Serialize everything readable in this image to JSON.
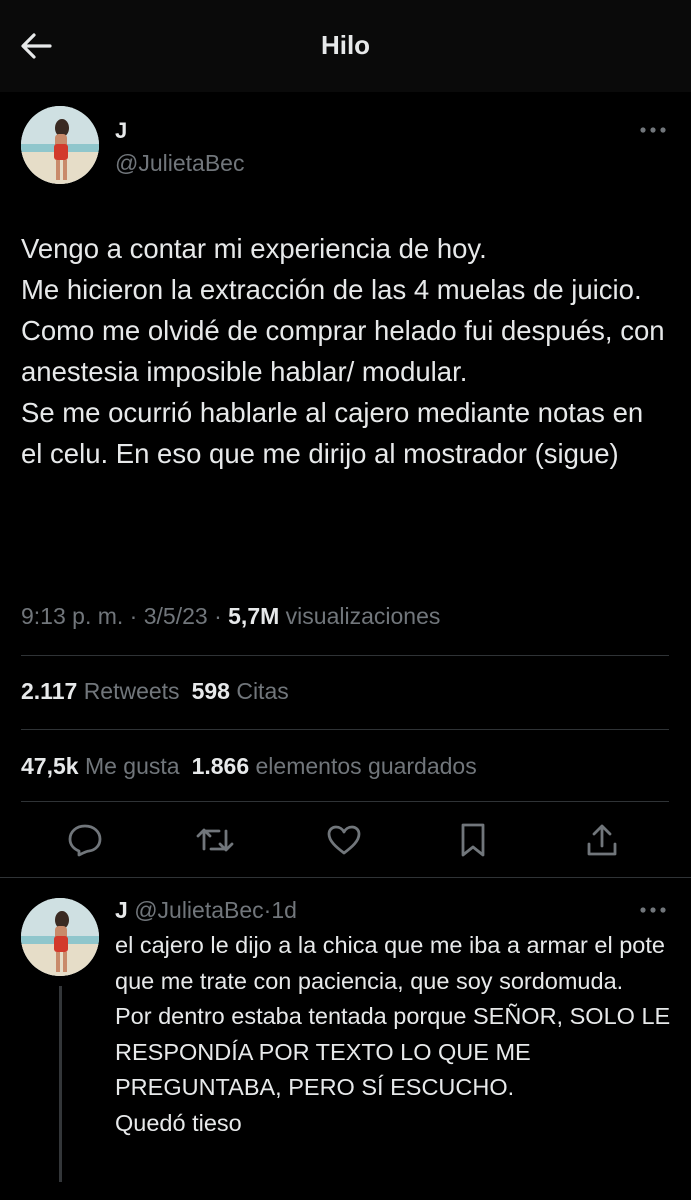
{
  "header": {
    "title": "Hilo"
  },
  "tweet": {
    "author_name": "J",
    "author_handle": "@JulietaBec",
    "text": "Vengo a contar mi experiencia de hoy.\nMe hicieron la extracción de las 4 muelas de juicio. Como me olvidé de comprar helado fui después, con anestesia imposible hablar/ modular.\nSe me ocurrió hablarle al cajero mediante notas en el celu. En eso que me dirijo al mostrador (sigue)",
    "time": "9:13 p. m.",
    "sep1": " · ",
    "date": "3/5/23",
    "sep2": " · ",
    "views_count": "5,7M",
    "views_label": "visualizaciones",
    "retweets_count": "2.117",
    "retweets_label": "Retweets",
    "quotes_count": "598",
    "quotes_label": "Citas",
    "likes_count": "47,5k",
    "likes_label": "Me gusta",
    "bookmarks_count": "1.866",
    "bookmarks_label": "elementos guardados"
  },
  "reply": {
    "author_name": "J",
    "author_handle": "@JulietaBec",
    "sep": "·",
    "time": "1d",
    "text": "el cajero le dijo a la chica que me iba a armar el pote  que me trate con paciencia, que soy sordomuda.\nPor dentro estaba tentada porque SEÑOR, SOLO LE RESPONDÍA POR TEXTO LO QUE ME PREGUNTABA, PERO SÍ ESCUCHO.\nQuedó tieso"
  },
  "icons": {
    "back": "arrow-left-icon",
    "more": "more-dots-icon",
    "reply": "comment-icon",
    "retweet": "retweet-icon",
    "like": "heart-icon",
    "bookmark": "bookmark-icon",
    "share": "share-icon"
  },
  "colors": {
    "background": "#000000",
    "header_background": "#0a0a0a",
    "text": "#e7e9ea",
    "secondary_text": "#71767b",
    "divider": "#2f3336"
  }
}
